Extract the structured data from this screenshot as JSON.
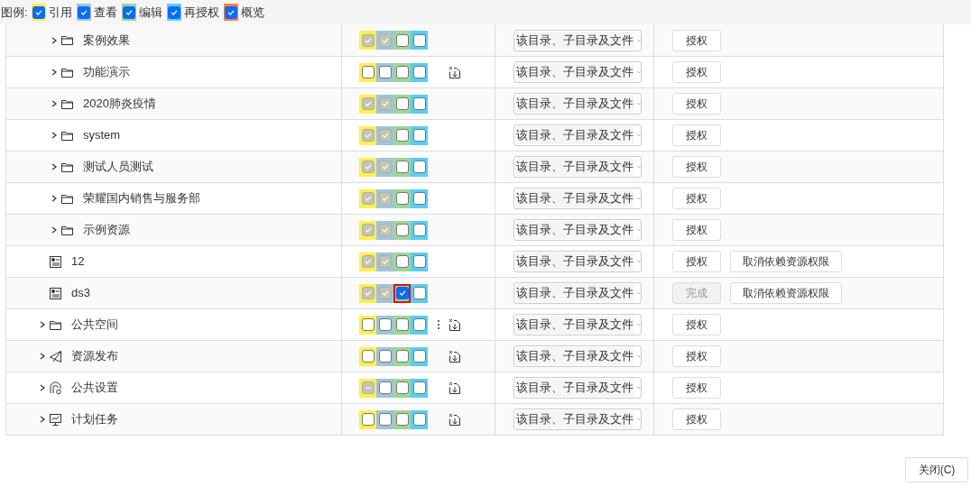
{
  "legend": {
    "label": "图例:",
    "items": [
      {
        "label": "引用",
        "checked": true,
        "color": "#fff04f"
      },
      {
        "label": "查看",
        "checked": true,
        "color": "#a0c4dc"
      },
      {
        "label": "编辑",
        "checked": true,
        "color": "#9dd69a"
      },
      {
        "label": "再授权",
        "checked": true,
        "color": "#55cff5"
      },
      {
        "label": "概览",
        "checked": true,
        "color": "#ff7d4f"
      }
    ]
  },
  "tree": [
    {
      "children": [
        {
          "name": "案例效果",
          "kind": "folder",
          "expandable": true,
          "perms": [
            {
              "checked": true,
              "disabled": true,
              "focused": false
            },
            {
              "checked": true,
              "disabled": true,
              "focused": false
            },
            {
              "checked": false,
              "disabled": false,
              "focused": false
            },
            {
              "checked": false,
              "disabled": false,
              "focused": false
            }
          ],
          "more": false,
          "import": false,
          "scope": "该目录、子目录及文件",
          "buttons": [
            {
              "label": "授权",
              "disabled": false
            }
          ]
        },
        {
          "name": "功能演示",
          "kind": "folder",
          "expandable": true,
          "perms": [
            {
              "checked": false,
              "disabled": false,
              "focused": false
            },
            {
              "checked": false,
              "disabled": false,
              "focused": false
            },
            {
              "checked": false,
              "disabled": false,
              "focused": false
            },
            {
              "checked": false,
              "disabled": false,
              "focused": false
            }
          ],
          "more": false,
          "import": true,
          "scope": "该目录、子目录及文件",
          "buttons": [
            {
              "label": "授权",
              "disabled": false
            }
          ]
        },
        {
          "name": "2020肺炎疫情",
          "kind": "folder",
          "expandable": true,
          "perms": [
            {
              "checked": true,
              "disabled": true,
              "focused": false
            },
            {
              "checked": true,
              "disabled": true,
              "focused": false
            },
            {
              "checked": false,
              "disabled": false,
              "focused": false
            },
            {
              "checked": false,
              "disabled": false,
              "focused": false
            }
          ],
          "more": false,
          "import": false,
          "scope": "该目录、子目录及文件",
          "buttons": [
            {
              "label": "授权",
              "disabled": false
            }
          ]
        },
        {
          "name": "system",
          "kind": "folder",
          "expandable": true,
          "perms": [
            {
              "checked": true,
              "disabled": true,
              "focused": false
            },
            {
              "checked": true,
              "disabled": true,
              "focused": false
            },
            {
              "checked": false,
              "disabled": false,
              "focused": false
            },
            {
              "checked": false,
              "disabled": false,
              "focused": false
            }
          ],
          "more": false,
          "import": false,
          "scope": "该目录、子目录及文件",
          "buttons": [
            {
              "label": "授权",
              "disabled": false
            }
          ]
        },
        {
          "name": "测试人员测试",
          "kind": "folder",
          "expandable": true,
          "perms": [
            {
              "checked": true,
              "disabled": true,
              "focused": false
            },
            {
              "checked": true,
              "disabled": true,
              "focused": false
            },
            {
              "checked": false,
              "disabled": false,
              "focused": false
            },
            {
              "checked": false,
              "disabled": false,
              "focused": false
            }
          ],
          "more": false,
          "import": false,
          "scope": "该目录、子目录及文件",
          "buttons": [
            {
              "label": "授权",
              "disabled": false
            }
          ]
        },
        {
          "name": "荣耀国内销售与服务部",
          "kind": "folder",
          "expandable": true,
          "perms": [
            {
              "checked": true,
              "disabled": true,
              "focused": false
            },
            {
              "checked": true,
              "disabled": true,
              "focused": false
            },
            {
              "checked": false,
              "disabled": false,
              "focused": false
            },
            {
              "checked": false,
              "disabled": false,
              "focused": false
            }
          ],
          "more": false,
          "import": false,
          "scope": "该目录、子目录及文件",
          "buttons": [
            {
              "label": "授权",
              "disabled": false
            }
          ]
        },
        {
          "name": "示例资源",
          "kind": "folder",
          "expandable": true,
          "perms": [
            {
              "checked": true,
              "disabled": true,
              "focused": false
            },
            {
              "checked": true,
              "disabled": true,
              "focused": false
            },
            {
              "checked": false,
              "disabled": false,
              "focused": false
            },
            {
              "checked": false,
              "disabled": false,
              "focused": false
            }
          ],
          "more": false,
          "import": false,
          "scope": "该目录、子目录及文件",
          "buttons": [
            {
              "label": "授权",
              "disabled": false
            }
          ]
        },
        {
          "name": "12",
          "kind": "resource",
          "expandable": false,
          "perms": [
            {
              "checked": true,
              "disabled": true,
              "focused": false
            },
            {
              "checked": true,
              "disabled": true,
              "focused": false
            },
            {
              "checked": false,
              "disabled": false,
              "focused": false
            },
            {
              "checked": false,
              "disabled": false,
              "focused": false
            }
          ],
          "more": false,
          "import": false,
          "scope": "该目录、子目录及文件",
          "buttons": [
            {
              "label": "授权",
              "disabled": false
            },
            {
              "label": "取消依赖资源权限",
              "disabled": false
            }
          ]
        },
        {
          "name": "ds3",
          "kind": "resource",
          "expandable": false,
          "perms": [
            {
              "checked": true,
              "disabled": true,
              "focused": false
            },
            {
              "checked": true,
              "disabled": true,
              "focused": false
            },
            {
              "checked": true,
              "disabled": false,
              "focused": true
            },
            {
              "checked": false,
              "disabled": false,
              "focused": false
            }
          ],
          "more": false,
          "import": false,
          "scope": "该目录、子目录及文件",
          "buttons": [
            {
              "label": "完成",
              "disabled": true
            },
            {
              "label": "取消依赖资源权限",
              "disabled": false
            }
          ]
        }
      ]
    },
    {
      "name": "公共空间",
      "kind": "folder",
      "expandable": true,
      "perms": [
        {
          "checked": false,
          "disabled": false,
          "focused": false
        },
        {
          "checked": false,
          "disabled": false,
          "focused": false
        },
        {
          "checked": false,
          "disabled": false,
          "focused": false
        },
        {
          "checked": false,
          "disabled": false,
          "focused": false
        }
      ],
      "more": true,
      "import": true,
      "scope": "该目录、子目录及文件",
      "buttons": [
        {
          "label": "授权",
          "disabled": false
        }
      ]
    },
    {
      "name": "资源发布",
      "kind": "publish",
      "expandable": true,
      "perms": [
        {
          "checked": false,
          "disabled": false,
          "focused": false
        },
        {
          "checked": false,
          "disabled": false,
          "focused": false
        },
        {
          "checked": false,
          "disabled": false,
          "focused": false
        },
        {
          "checked": false,
          "disabled": false,
          "focused": false
        }
      ],
      "more": false,
      "import": true,
      "scope": "该目录、子目录及文件",
      "buttons": [
        {
          "label": "授权",
          "disabled": false
        }
      ]
    },
    {
      "name": "公共设置",
      "kind": "settings",
      "expandable": true,
      "perms": [
        {
          "kind": "partial",
          "checked": false,
          "disabled": true,
          "focused": false
        },
        {
          "checked": false,
          "disabled": false,
          "focused": false
        },
        {
          "checked": false,
          "disabled": false,
          "focused": false
        },
        {
          "checked": false,
          "disabled": false,
          "focused": false
        }
      ],
      "more": false,
      "import": true,
      "scope": "该目录、子目录及文件",
      "buttons": [
        {
          "label": "授权",
          "disabled": false
        }
      ]
    },
    {
      "name": "计划任务",
      "kind": "schedule",
      "expandable": true,
      "perms": [
        {
          "checked": false,
          "disabled": false,
          "focused": false
        },
        {
          "checked": false,
          "disabled": false,
          "focused": false
        },
        {
          "checked": false,
          "disabled": false,
          "focused": false
        },
        {
          "checked": false,
          "disabled": false,
          "focused": false
        }
      ],
      "more": false,
      "import": true,
      "scope": "该目录、子目录及文件",
      "buttons": [
        {
          "label": "授权",
          "disabled": false
        }
      ]
    }
  ],
  "close_button": "关闭(C)"
}
